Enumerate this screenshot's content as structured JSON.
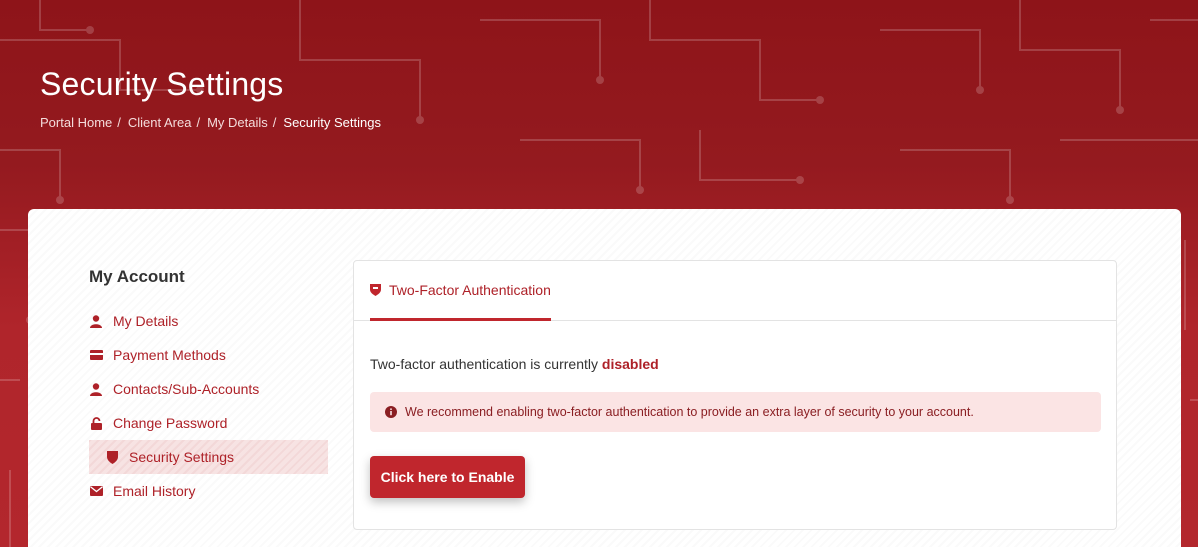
{
  "header": {
    "title": "Security Settings",
    "breadcrumb": [
      {
        "label": "Portal Home"
      },
      {
        "label": "Client Area"
      },
      {
        "label": "My Details"
      },
      {
        "label": "Security Settings"
      }
    ],
    "separator": "/"
  },
  "sidebar": {
    "title": "My Account",
    "items": [
      {
        "label": "My Details",
        "icon": "user-icon"
      },
      {
        "label": "Payment Methods",
        "icon": "credit-card-icon"
      },
      {
        "label": "Contacts/Sub-Accounts",
        "icon": "user-icon"
      },
      {
        "label": "Change Password",
        "icon": "lock-icon"
      },
      {
        "label": "Security Settings",
        "icon": "shield-icon",
        "active": true
      },
      {
        "label": "Email History",
        "icon": "envelope-icon"
      }
    ]
  },
  "main": {
    "tab_label": "Two-Factor Authentication",
    "status_prefix": "Two-factor authentication is currently",
    "status_value": "disabled",
    "alert_text": "We recommend enabling two-factor authentication to provide an extra layer of security to your account.",
    "enable_button": "Click here to Enable"
  },
  "colors": {
    "brand": "#c0262d",
    "link": "#ae2128",
    "alert_bg": "#fbe4e4",
    "header_bg": "#941a1f"
  }
}
